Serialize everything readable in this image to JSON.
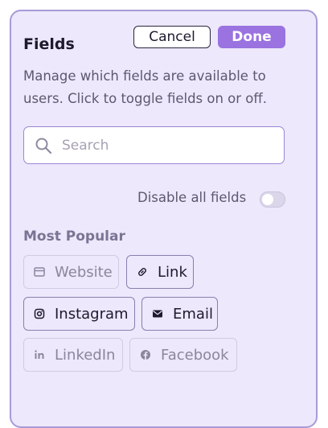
{
  "panel": {
    "title": "Fields",
    "cancel_label": "Cancel",
    "done_label": "Done",
    "description": "Manage which fields are available to users. Click to toggle fields on or off.",
    "search": {
      "placeholder": "Search",
      "value": ""
    },
    "disable_all": {
      "label": "Disable all fields",
      "enabled": false
    },
    "sections": [
      {
        "title": "Most Popular",
        "fields": [
          {
            "label": "Website",
            "icon": "browser-window-icon",
            "enabled": false
          },
          {
            "label": "Link",
            "icon": "link-icon",
            "enabled": true
          },
          {
            "label": "Instagram",
            "icon": "instagram-icon",
            "enabled": true
          },
          {
            "label": "Email",
            "icon": "envelope-icon",
            "enabled": true
          },
          {
            "label": "LinkedIn",
            "icon": "linkedin-icon",
            "enabled": false
          },
          {
            "label": "Facebook",
            "icon": "facebook-icon",
            "enabled": false
          }
        ]
      }
    ]
  },
  "colors": {
    "accent": "#9a73e0",
    "panel_background": "#ede8fb",
    "panel_border": "#a99ad8",
    "enabled_text": "#1e1a2e",
    "disabled_text": "#8c869c"
  }
}
